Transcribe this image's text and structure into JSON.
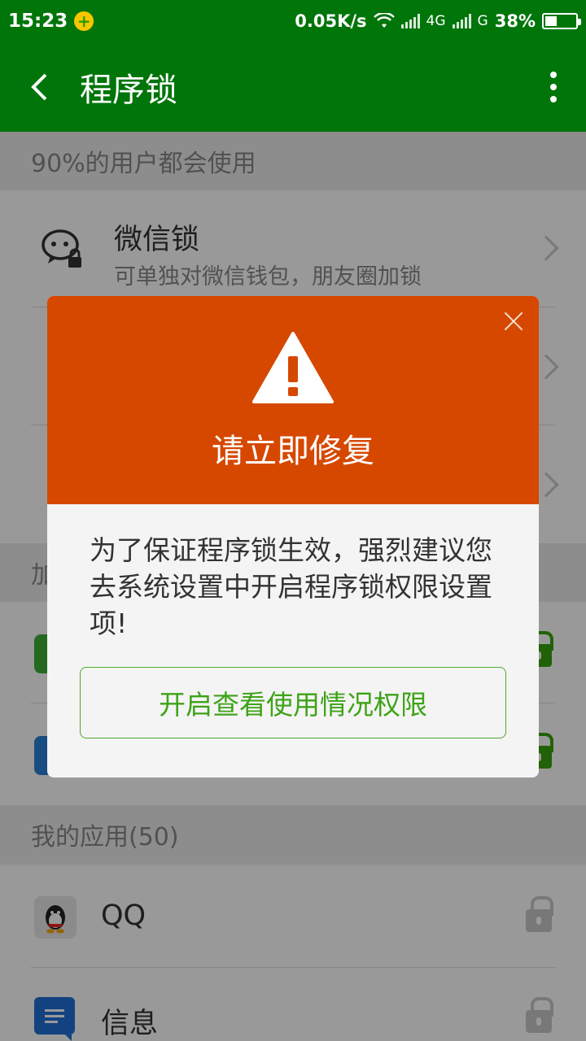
{
  "status_bar": {
    "time": "15:23",
    "network_speed": "0.05K/s",
    "net_4g": "4G",
    "net_g": "G",
    "battery": "38%",
    "battery_level": 0.38
  },
  "app_bar": {
    "title": "程序锁",
    "back_icon": "chevron-left-icon",
    "more_icon": "more-vert-icon"
  },
  "sections": {
    "popular": "90%的用户都会使用",
    "locked_prefix": "加",
    "my_apps": "我的应用(50)"
  },
  "popular_items": [
    {
      "title": "微信锁",
      "subtitle": "可单独对微信钱包，朋友圈加锁",
      "icon": "chat-lock-icon"
    }
  ],
  "my_apps": [
    {
      "name": "QQ",
      "icon": "qq-icon"
    },
    {
      "name": "信息",
      "icon": "messages-icon"
    }
  ],
  "dialog": {
    "title": "请立即修复",
    "message": "为了保证程序锁生效，强烈建议您去系统设置中开启程序锁权限设置项!",
    "button": "开启查看使用情况权限",
    "colors": {
      "header": "#d64800",
      "button": "#3ea317"
    }
  },
  "colors": {
    "primary": "#00750a",
    "lock_green": "#38a40a"
  }
}
